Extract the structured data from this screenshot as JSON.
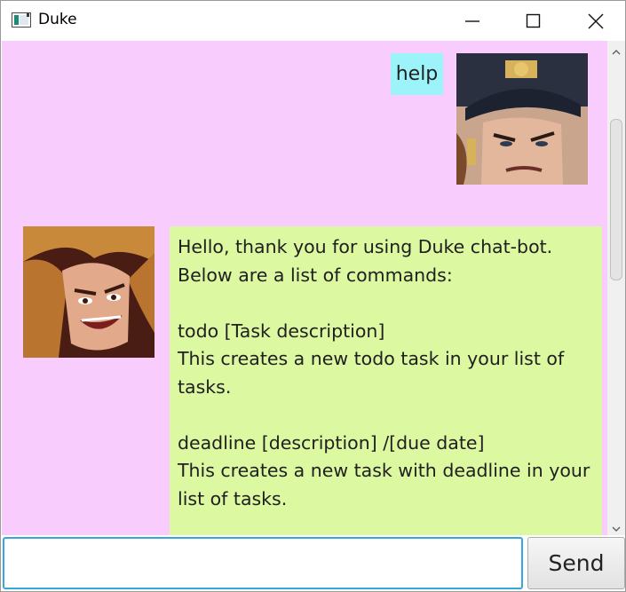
{
  "window": {
    "title": "Duke"
  },
  "chat": {
    "messages": [
      {
        "sender": "user",
        "text": "help"
      },
      {
        "sender": "bot",
        "text": "Hello, thank you for using Duke chat-bot.\nBelow are a list of commands:\n\ntodo [Task description]\nThis creates a new todo task in your list of tasks.\n\ndeadline [description] /[due date]\nThis creates a new task with deadline in your list of tasks."
      }
    ]
  },
  "input": {
    "value": "",
    "placeholder": ""
  },
  "send_button": {
    "label": "Send"
  },
  "colors": {
    "chat_background": "#f8ccfc",
    "user_bubble": "#9cf3fa",
    "bot_bubble": "#dcf8a0",
    "input_focus_border": "#37a7dc"
  },
  "icons": {
    "app": "app-window-icon",
    "minimize": "minimize-icon",
    "maximize": "maximize-icon",
    "close": "close-icon"
  }
}
